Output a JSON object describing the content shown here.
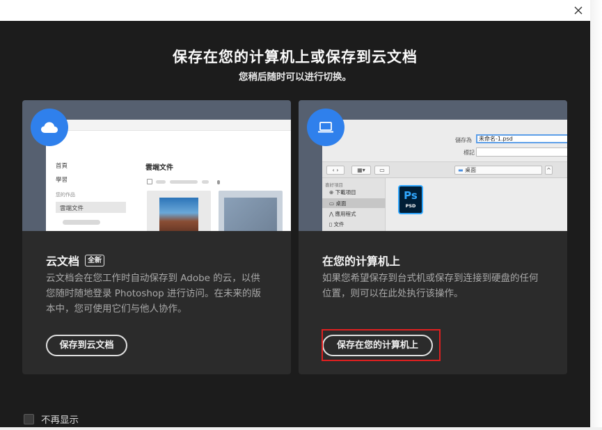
{
  "window": {
    "close_icon": "close-icon"
  },
  "dialog": {
    "title": "保存在您的计算机上或保存到云文档",
    "subtitle": "您稍后随时可以进行切换。"
  },
  "cloud_card": {
    "icon": "cloud-icon",
    "heading": "云文档",
    "badge": "全新",
    "description": "云文档会在您工作时自动保存到 Adobe 的云，以供您随时随地登录 Photoshop 进行访问。在未来的版本中，您可使用它们与他人协作。",
    "button": "保存到云文档",
    "preview": {
      "nav_home": "首頁",
      "nav_learn": "學習",
      "nav_section": "您的作品",
      "nav_cloud": "雲端文件",
      "content_title": "雲端文件"
    }
  },
  "local_card": {
    "icon": "laptop-icon",
    "heading": "在您的计算机上",
    "description": "如果您希望保存到台式机或保存到连接到硬盘的任何位置，则可以在此处执行该操作。",
    "button": "保存在您的计算机上",
    "preview": {
      "save_as_label": "儲存為",
      "save_as_value": "未命名-1.psd",
      "tags_label": "標記",
      "location": "桌面",
      "favorites_header": "喜好項目",
      "favorites": [
        "下載項目",
        "桌面",
        "應用程式",
        "文件"
      ],
      "file_icon_text": "Ps",
      "file_icon_sub": "PSD"
    }
  },
  "footer": {
    "dont_show_label": "不再显示",
    "checked": false
  },
  "colors": {
    "accent_blue": "#2f80ec",
    "highlight_red": "#e02020",
    "dialog_bg": "#1c1c1c",
    "card_bg": "#2b2b2b"
  }
}
